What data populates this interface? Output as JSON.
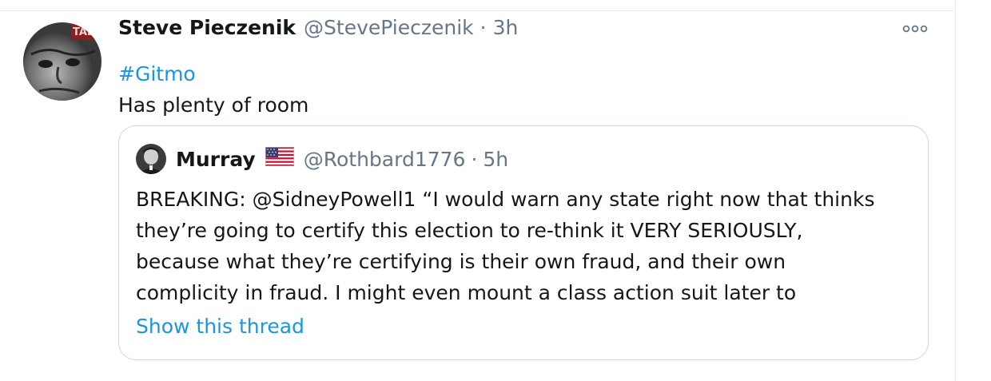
{
  "tweet": {
    "display_name": "Steve Pieczenik",
    "handle": "@StevePieczenik",
    "separator": "·",
    "time": "3h",
    "hashtag": "#Gitmo",
    "text": "Has plenty of room",
    "more_icon": "more-horizontal-icon",
    "avatar_badge_text": "TALK"
  },
  "quoted_tweet": {
    "display_name": "Murray",
    "flag_icon": "us-flag-icon",
    "handle": "@Rothbard1776",
    "separator": "·",
    "time": "5h",
    "text_lines": [
      "BREAKING: @SidneyPowell1 “I would warn any state right now that thinks",
      "they’re going to certify this election to re-think it VERY SERIOUSLY,",
      "because what they’re certifying is their own fraud, and their own",
      "complicity in fraud. I might even mount a class action suit later to"
    ],
    "show_thread": "Show this thread"
  },
  "colors": {
    "link_blue": "#1b95e0",
    "secondary_gray": "#657786",
    "border": "#ccd6dd",
    "text": "#14171a"
  }
}
